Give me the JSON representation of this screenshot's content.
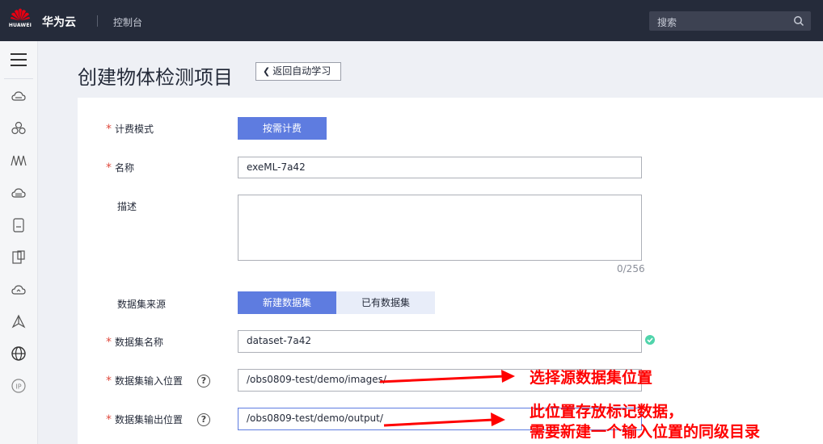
{
  "topbar": {
    "logo_text": "HUAWEI",
    "brand": "华为云",
    "console": "控制台",
    "search_placeholder": "搜索"
  },
  "page": {
    "title": "创建物体检测项目",
    "back_label": "返回自动学习"
  },
  "form": {
    "billing": {
      "label": "计费模式",
      "required": true,
      "value": "按需计费"
    },
    "name": {
      "label": "名称",
      "required": true,
      "value": "exeML-7a42"
    },
    "description": {
      "label": "描述",
      "required": false,
      "value": "",
      "counter": "0/256"
    },
    "dataset_source": {
      "label": "数据集来源",
      "options": [
        "新建数据集",
        "已有数据集"
      ],
      "selected": "新建数据集"
    },
    "dataset_name": {
      "label": "数据集名称",
      "required": true,
      "value": "dataset-7a42",
      "valid": true
    },
    "input_location": {
      "label": "数据集输入位置",
      "required": true,
      "value": "/obs0809-test/demo/images/",
      "help": "?"
    },
    "output_location": {
      "label": "数据集输出位置",
      "required": true,
      "value": "/obs0809-test/demo/output/",
      "help": "?"
    }
  },
  "annotations": {
    "input_note": "选择源数据集位置",
    "output_note_line1": "此位置存放标记数据，",
    "output_note_line2": "需要新建一个输入位置的同级目录"
  },
  "colors": {
    "topbar": "#252b3a",
    "primary": "#5e7ce0",
    "required_star": "#e04b3f",
    "valid_check": "#50d4ab",
    "annotation": "#ff0000"
  },
  "sidebar_icons": [
    "menu-icon",
    "cloud-server-icon",
    "cluster-icon",
    "network-icon",
    "storage-icon",
    "database-icon",
    "document-icon",
    "cloud-icon",
    "ai-icon",
    "globe-icon",
    "ip-icon"
  ]
}
